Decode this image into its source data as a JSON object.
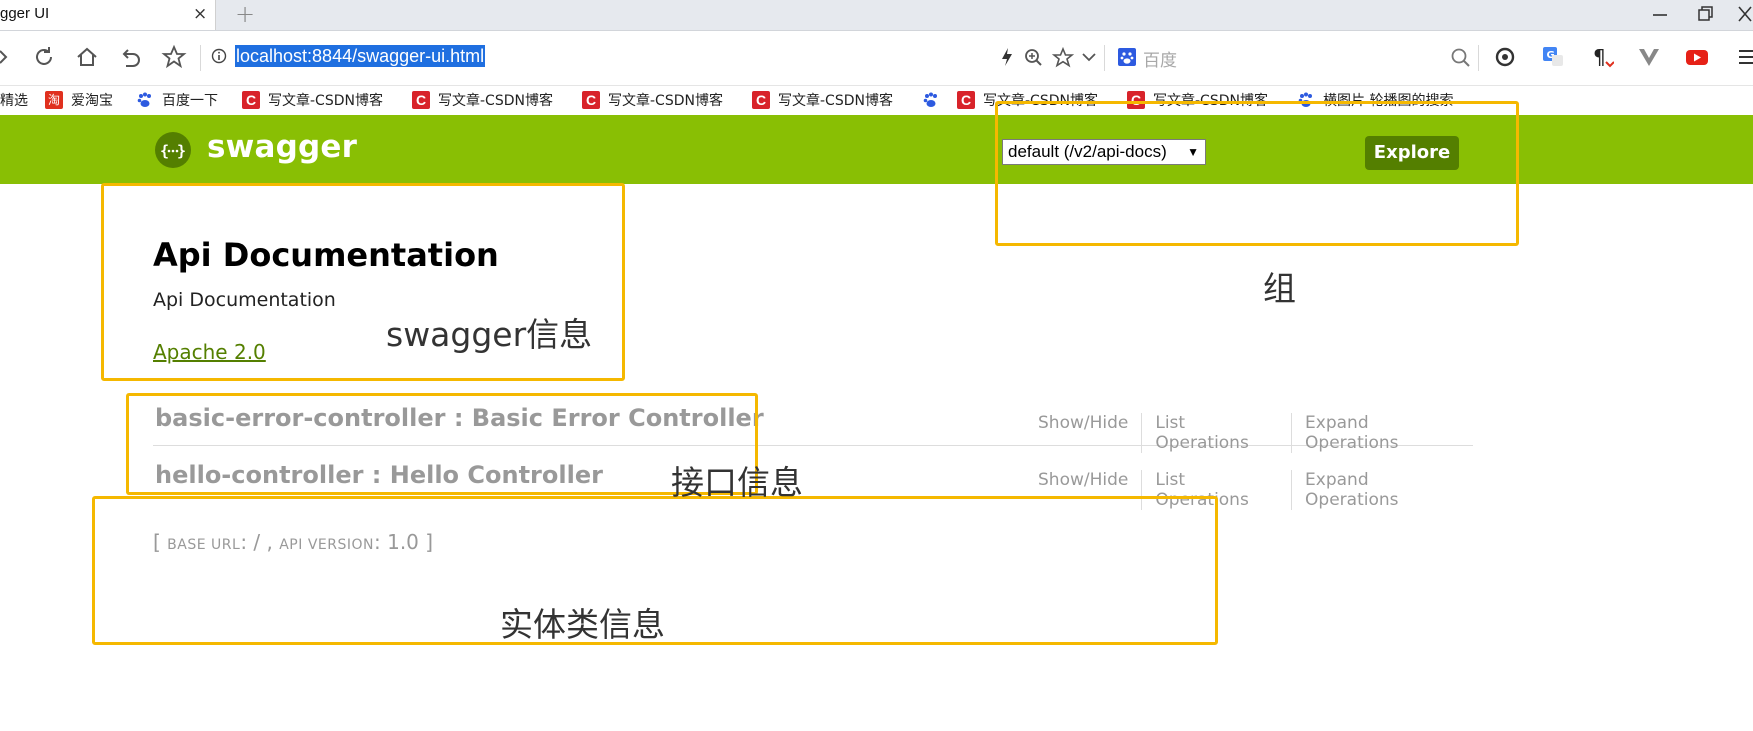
{
  "browser": {
    "tab_title": "gger UI",
    "tab_close": "×",
    "new_tab": "+",
    "url": "localhost:8844/swagger-ui.html",
    "search_placeholder": "百度",
    "bookmarks": [
      {
        "label": "精选",
        "icon": "none"
      },
      {
        "label": "爱淘宝",
        "icon": "taobao-icon"
      },
      {
        "label": "百度一下",
        "icon": "baidu-paw-icon"
      },
      {
        "label": "写文章-CSDN博客",
        "icon": "csdn-icon"
      },
      {
        "label": "写文章-CSDN博客",
        "icon": "csdn-icon"
      },
      {
        "label": "写文章-CSDN博客",
        "icon": "csdn-icon"
      },
      {
        "label": "写文章-CSDN博客",
        "icon": "csdn-icon"
      },
      {
        "label": "",
        "icon": "baidu-paw-icon"
      },
      {
        "label": "写文章-CSDN博客",
        "icon": "csdn-icon"
      },
      {
        "label": "写文章-CSDN博客",
        "icon": "csdn-icon"
      },
      {
        "label": "横图片 轮播图的搜索",
        "icon": "baidu-paw-icon"
      }
    ]
  },
  "swagger": {
    "brand": "swagger",
    "group_select": "default (/v2/api-docs)",
    "explore_label": "Explore",
    "title": "Api Documentation",
    "description": "Api Documentation",
    "license": "Apache 2.0",
    "controllers": [
      {
        "name": "basic-error-controller : Basic Error Controller",
        "show_hide": "Show/Hide",
        "list_ops": "List Operations",
        "expand_ops": "Expand Operations"
      },
      {
        "name": "hello-controller : Hello Controller",
        "show_hide": "Show/Hide",
        "list_ops": "List Operations",
        "expand_ops": "Expand Operations"
      }
    ],
    "footer": {
      "open_bracket": "[",
      "base_url_label": "base url",
      "base_url_value": ": / ,",
      "api_version_label": "api version",
      "api_version_value": ": 1.0",
      "close_bracket": "]"
    }
  },
  "annotations": {
    "swagger_info": "swagger信息",
    "group": "组",
    "interface_info": "接口信息",
    "entity_info": "实体类信息"
  },
  "colors": {
    "swagger_green": "#89bf04",
    "explore_button": "#547f00",
    "annotation_box": "#f5b800",
    "url_highlight": "#1f6fe0"
  }
}
